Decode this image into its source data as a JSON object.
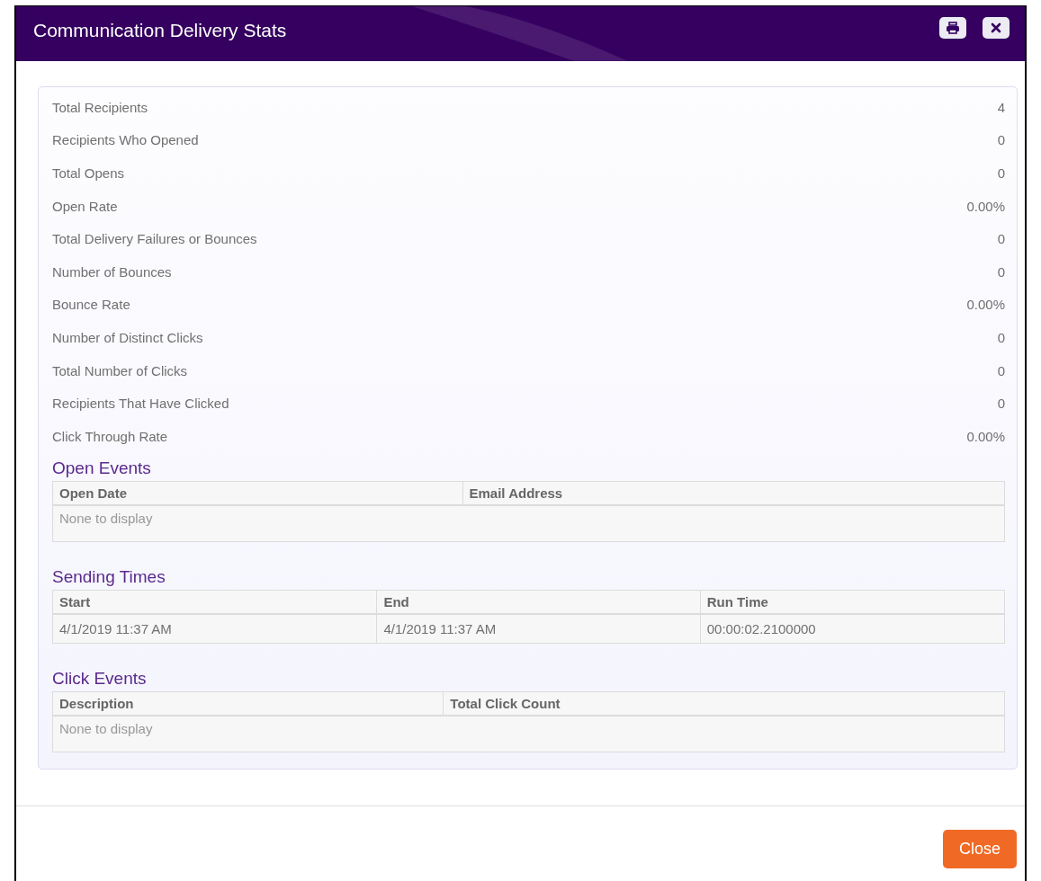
{
  "window": {
    "title": "Communication Delivery Stats"
  },
  "stats": [
    {
      "label": "Total Recipients",
      "value": "4"
    },
    {
      "label": "Recipients Who Opened",
      "value": "0"
    },
    {
      "label": "Total Opens",
      "value": "0"
    },
    {
      "label": "Open Rate",
      "value": "0.00%"
    },
    {
      "label": "Total Delivery Failures or Bounces",
      "value": "0"
    },
    {
      "label": "Number of Bounces",
      "value": "0"
    },
    {
      "label": "Bounce Rate",
      "value": "0.00%"
    },
    {
      "label": "Number of Distinct Clicks",
      "value": "0"
    },
    {
      "label": "Total Number of Clicks",
      "value": "0"
    },
    {
      "label": "Recipients That Have Clicked",
      "value": "0"
    },
    {
      "label": "Click Through Rate",
      "value": "0.00%"
    }
  ],
  "sections": [
    {
      "title": "Open Events",
      "columns": [
        "Open Date",
        "Email Address"
      ],
      "empty_text": "None to display"
    },
    {
      "title": "Sending Times",
      "columns": [
        "Start",
        "End",
        "Run Time"
      ],
      "rows": [
        [
          "4/1/2019 11:37 AM",
          "4/1/2019 11:37 AM",
          "00:00:02.2100000"
        ]
      ]
    },
    {
      "title": "Click Events",
      "columns": [
        "Description",
        "Total Click Count"
      ],
      "empty_text": "None to display"
    }
  ],
  "buttons": [
    "Close"
  ]
}
